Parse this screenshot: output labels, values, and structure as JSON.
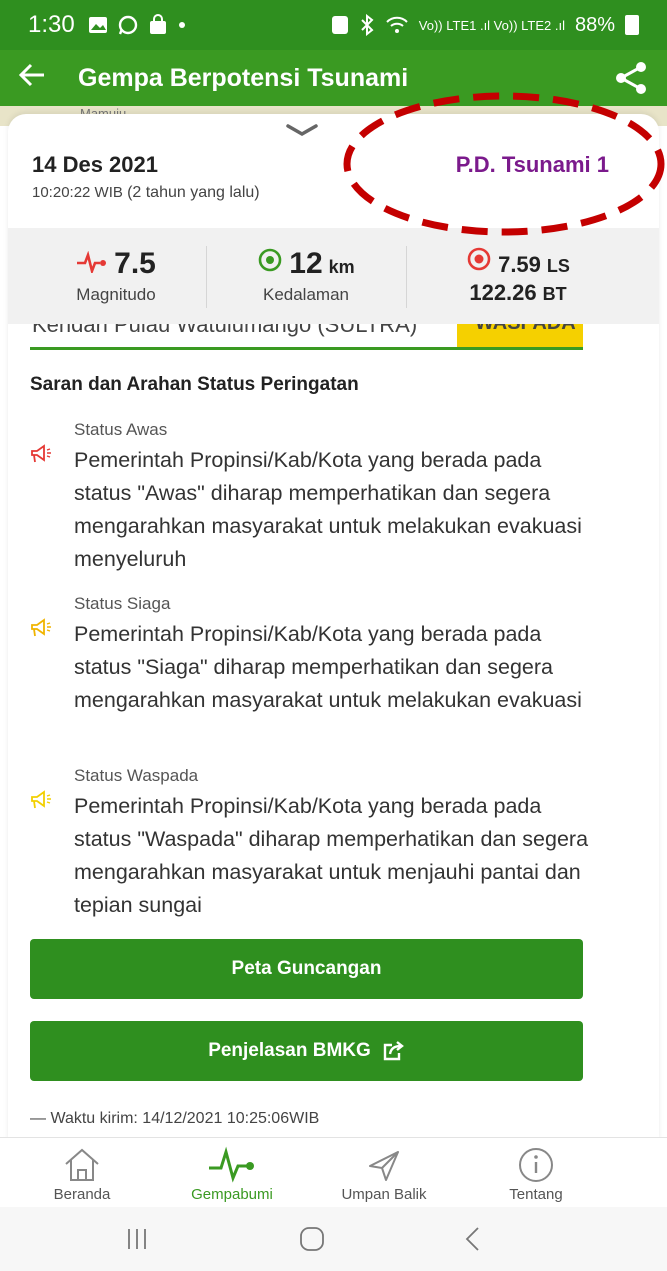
{
  "status_bar": {
    "time": "1:30",
    "signal_text": "Vo)) LTE1 .ıl Vo)) LTE2 .ıl",
    "battery": "88%"
  },
  "app_bar": {
    "title": "Gempa Berpotensi Tsunami",
    "back_icon": "arrow-left-icon",
    "share_icon": "share-icon"
  },
  "map": {
    "label": "Mamuju"
  },
  "event": {
    "date": "14 Des 2021",
    "time": "10:20:22 WIB",
    "ago": "(2 tahun yang lalu)",
    "tsunami_status": "P.D. Tsunami 1"
  },
  "stats": {
    "magnitude_value": "7.5",
    "magnitude_label": "Magnitudo",
    "depth_value": "12",
    "depth_unit": "km",
    "depth_label": "Kedalaman",
    "lat_value": "7.59",
    "lat_unit": "LS",
    "lon_value": "122.26",
    "lon_unit": "BT"
  },
  "partial_row": {
    "text": "Kendari Pulau Watulumango (SULTRA)",
    "badge": "WASPADA"
  },
  "advice": {
    "title": "Saran dan Arahan Status Peringatan",
    "items": [
      {
        "label": "Status Awas",
        "desc": "Pemerintah Propinsi/Kab/Kota yang berada pada status \"Awas\" diharap memperhatikan dan segera mengarahkan masyarakat untuk melakukan evakuasi menyeluruh",
        "color": "#e53935"
      },
      {
        "label": "Status Siaga",
        "desc": "Pemerintah Propinsi/Kab/Kota yang berada pada status \"Siaga\" diharap memperhatikan dan segera mengarahkan masyarakat untuk melakukan evakuasi",
        "color": "#f0b400"
      },
      {
        "label": "Status Waspada",
        "desc": "Pemerintah Propinsi/Kab/Kota yang berada pada status \"Waspada\" diharap memperhatikan dan segera mengarahkan masyarakat untuk menjauhi pantai dan tepian sungai",
        "color": "#f2d000"
      }
    ]
  },
  "buttons": {
    "shake_map": "Peta Guncangan",
    "bmkg_info": "Penjelasan BMKG"
  },
  "sent_time": "— Waktu kirim: 14/12/2021 10:25:06WIB",
  "bottom_nav": [
    {
      "label": "Beranda",
      "icon": "home-icon"
    },
    {
      "label": "Gempabumi",
      "icon": "pulse-icon"
    },
    {
      "label": "Umpan Balik",
      "icon": "send-icon"
    },
    {
      "label": "Tentang",
      "icon": "info-icon"
    }
  ],
  "colors": {
    "primary_green": "#3a9a22",
    "dark_green": "#2f8f1f",
    "tsunami_purple": "#7b1a8c",
    "warning_yellow": "#f5d000",
    "annotation_red": "#c40000"
  }
}
